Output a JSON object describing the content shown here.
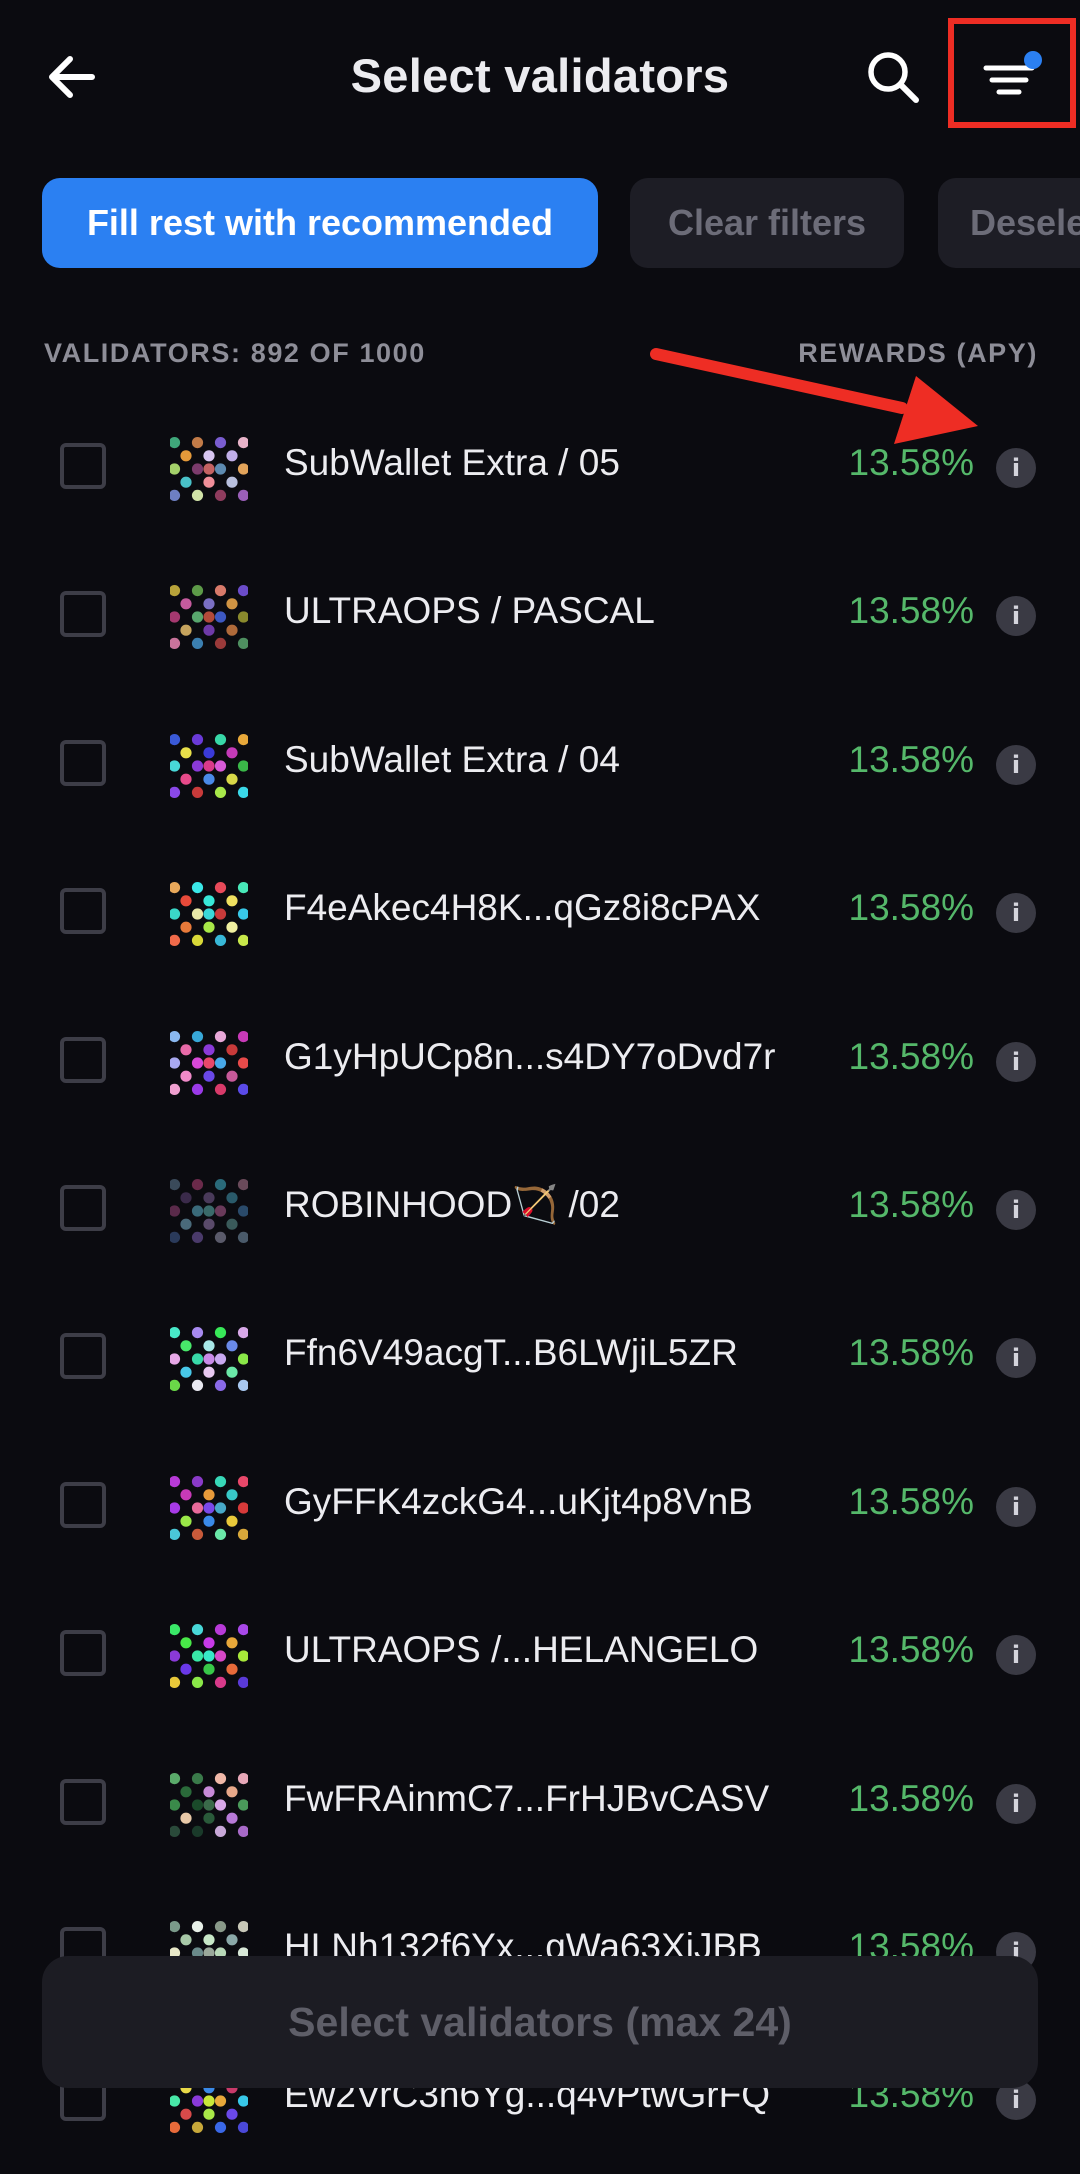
{
  "header": {
    "title": "Select validators",
    "back_icon": "arrow-left-icon",
    "search_icon": "search-icon",
    "filter_icon": "filter-lines-icon",
    "filter_active_dot_color": "#2b80f2",
    "annotation_box_color": "#ee2d24"
  },
  "chips": {
    "fill_recommended": "Fill rest with recommended",
    "clear_filters": "Clear filters",
    "deselect": "Desele"
  },
  "list_header": {
    "count": "VALIDATORS: 892 OF 1000",
    "rewards": "REWARDS (APY)"
  },
  "annotation": {
    "arrow_color": "#ee2d24"
  },
  "validators": [
    {
      "name": "SubWallet Extra / 05",
      "apy": "13.58%",
      "colors": [
        "#e59a3a",
        "#d7c5f0",
        "#c0aee8",
        "#a4d16a",
        "#7b3b6c",
        "#5d8ab0",
        "#e3a45b",
        "#49c1c8",
        "#f08f9a",
        "#b9c0de",
        "#c27b48",
        "#7a5dd0",
        "#d1e3a8",
        "#8f3c5e",
        "#3fa77a",
        "#e8b3c9",
        "#6e7fc2",
        "#9a5fb8",
        "#c46262"
      ]
    },
    {
      "name": "ULTRAOPS / PASCAL",
      "apy": "13.58%",
      "colors": [
        "#c55b9e",
        "#7a6fc3",
        "#d09443",
        "#a5386f",
        "#58a66d",
        "#3d58c2",
        "#8a8a2d",
        "#c6a45e",
        "#6e3aa8",
        "#b06a3a",
        "#5d9a48",
        "#d87a6a",
        "#3b7fb0",
        "#9a3a3a",
        "#b8a33a",
        "#6b4cc9",
        "#c9739b",
        "#4e8f60",
        "#b24a3a"
      ]
    },
    {
      "name": "SubWallet Extra / 04",
      "apy": "13.58%",
      "colors": [
        "#e8e04a",
        "#3a3ad8",
        "#c43ab8",
        "#48d8d8",
        "#8a3ad8",
        "#d85ad8",
        "#3ab848",
        "#e84a8a",
        "#4a8ae8",
        "#d8d848",
        "#6a3ad8",
        "#38d8a8",
        "#c83a3a",
        "#a8e84a",
        "#3a5ad8",
        "#e8a83a",
        "#8a48e8",
        "#3ad8e8",
        "#d83a8a"
      ]
    },
    {
      "name": "F4eAkec4H8K...qGz8i8cPAX",
      "apy": "13.58%",
      "colors": [
        "#e84a3a",
        "#38e8d8",
        "#f0e060",
        "#3ad8c8",
        "#e8e8a8",
        "#c83a3a",
        "#38c8e8",
        "#e87a3a",
        "#a8e848",
        "#f0f0a0",
        "#3ae8e8",
        "#e84a5a",
        "#d8d838",
        "#38b8d8",
        "#e8a85a",
        "#48e8b8",
        "#f06a4a",
        "#c8e84a",
        "#3ad8d8"
      ]
    },
    {
      "name": "G1yHpUCp8n...s4DY7oDvd7r",
      "apy": "13.58%",
      "colors": [
        "#e86aa8",
        "#8a3ad8",
        "#c83a3a",
        "#a8a8f0",
        "#d848d8",
        "#48a8e8",
        "#e84a4a",
        "#f08ac8",
        "#6a48e8",
        "#c85a9a",
        "#38a8d8",
        "#e8a8d8",
        "#9a3ae8",
        "#d83a6a",
        "#8ab8f0",
        "#c83ab8",
        "#f0a0d0",
        "#5a4ae8",
        "#e8486a"
      ]
    },
    {
      "name": "ROBINHOOD🏹 /02",
      "apy": "13.58%",
      "colors": [
        "#3a2a4a",
        "#4a3a5a",
        "#2a5a6a",
        "#5a2a4a",
        "#3a6a7a",
        "#6a3a5a",
        "#2a4a6a",
        "#4a6a7a",
        "#5a4a6a",
        "#3a5a5a",
        "#6a2a4a",
        "#2a6a7a",
        "#4a3a6a",
        "#5a5a6a",
        "#3a4a5a",
        "#6a4a5a",
        "#2a3a5a",
        "#4a5a6a",
        "#3a6a6a"
      ]
    },
    {
      "name": "Ffn6V49acgT...B6LWjiL5ZR",
      "apy": "13.58%",
      "colors": [
        "#48e86a",
        "#a8e8e8",
        "#6a8ae8",
        "#e8a8e8",
        "#38d8a8",
        "#c8a8f0",
        "#8ae848",
        "#48c8e8",
        "#e8c8f0",
        "#6ae8a8",
        "#a88af0",
        "#38e858",
        "#e8e8f0",
        "#8a6ae8",
        "#48e8c8",
        "#d8a8e8",
        "#6ad848",
        "#a8c8f0",
        "#c88ae8"
      ]
    },
    {
      "name": "GyFFK4zckG4...uKjt4p8VnB",
      "apy": "13.58%",
      "colors": [
        "#c83ab8",
        "#e89a3a",
        "#38c8c8",
        "#a83ae8",
        "#e86a9a",
        "#48a8c8",
        "#d83a3a",
        "#9ae848",
        "#3a8ae8",
        "#e8c83a",
        "#8a3ac8",
        "#38d8b8",
        "#c85a3a",
        "#6ae8a8",
        "#b83ad8",
        "#e8486a",
        "#4ac8d8",
        "#d8a83a",
        "#7a48e8"
      ]
    },
    {
      "name": "ULTRAOPS /...HELANGELO",
      "apy": "13.58%",
      "colors": [
        "#48e848",
        "#c83ae8",
        "#e8a83a",
        "#8a3ad8",
        "#38e8a8",
        "#d848c8",
        "#a8e83a",
        "#6a38e8",
        "#38c848",
        "#e86a3a",
        "#48d8d8",
        "#b83ad8",
        "#8ae848",
        "#d83a8a",
        "#3ae868",
        "#a848e8",
        "#e8c83a",
        "#5a3ad8",
        "#38e8c8"
      ]
    },
    {
      "name": "FwFRAinmC7...FrHJBvCASV",
      "apy": "13.58%",
      "colors": [
        "#2a6a3a",
        "#c88ad8",
        "#e8a88a",
        "#3a8a4a",
        "#1a4a2a",
        "#d8a8e8",
        "#4a9a5a",
        "#e8c8a8",
        "#2a5a3a",
        "#b87ad8",
        "#3a7a4a",
        "#f0b8a8",
        "#1a3a2a",
        "#c8a8d8",
        "#5aaa6a",
        "#e8a8b8",
        "#2a4a3a",
        "#a86ac8",
        "#3a6a4a"
      ]
    },
    {
      "name": "HLNh132f6Yx...gWa63XiJBB",
      "apy": "13.58%",
      "colors": [
        "#a8c8a8",
        "#c8e8c8",
        "#8aa8a8",
        "#e8e8c8",
        "#6a8a8a",
        "#b8d8b8",
        "#d8e8d8",
        "#9ab8a8",
        "#c8d8c8",
        "#a8b8a8",
        "#e8f0e8",
        "#8a9a8a",
        "#b8c8b8",
        "#d8d8c8",
        "#7a9a8a",
        "#c8c8b8",
        "#a8a8a8",
        "#e8e8d8",
        "#9aa89a"
      ]
    },
    {
      "name": "Ew2VrC3n6Yg...q4vPtwGrFQ",
      "apy": "13.58%",
      "colors": [
        "#e8d848",
        "#3a8ae8",
        "#c83a6a",
        "#48e8a8",
        "#8a3ad8",
        "#e8a83a",
        "#38c8e8",
        "#d84a4a",
        "#a8e848",
        "#6a48e8",
        "#e8486a",
        "#48d8c8",
        "#c8a83a",
        "#3a68e8",
        "#d83ab8",
        "#8ae8a8",
        "#e86a3a",
        "#4a48d8",
        "#c8e83a"
      ]
    }
  ],
  "footer": {
    "cta": "Select validators (max 24)"
  }
}
